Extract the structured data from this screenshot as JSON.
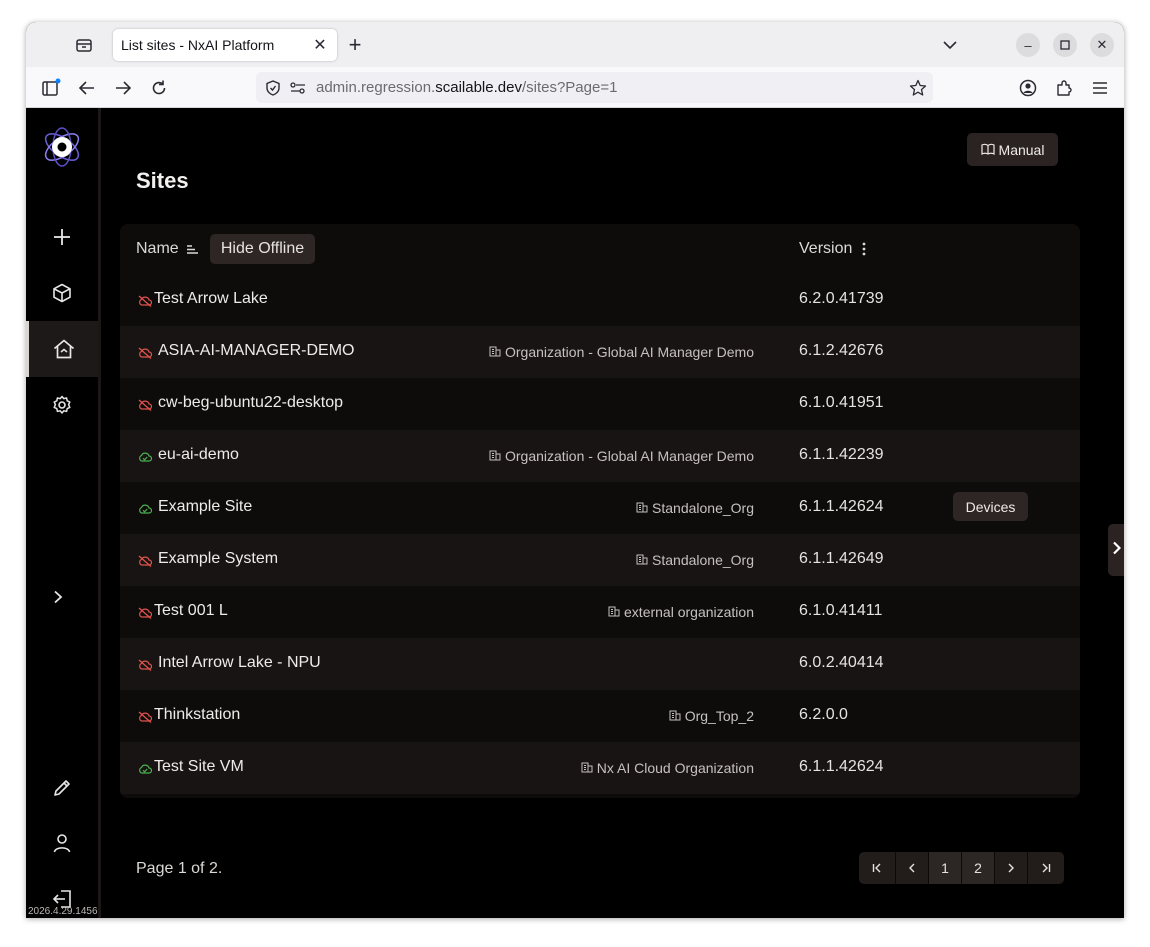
{
  "browser": {
    "tab_title": "List sites - NxAI Platform",
    "url_prefix": "admin.regression.",
    "url_domain": "scailable.dev",
    "url_path": "/sites?Page=1"
  },
  "sidebar": {
    "version": "2026.4.29.1456"
  },
  "page": {
    "title": "Sites",
    "manual_label": "Manual"
  },
  "table": {
    "col_name": "Name",
    "hide_offline_label": "Hide Offline",
    "col_version": "Version",
    "devices_label": "Devices",
    "rows": [
      {
        "name": "Test Arrow Lake",
        "org": "",
        "version": "6.2.0.41739",
        "status": "offline"
      },
      {
        "name": "ASIA-AI-MANAGER-DEMO",
        "org": "Organization - Global AI Manager Demo",
        "version": "6.1.2.42676",
        "status": "offline"
      },
      {
        "name": "cw-beg-ubuntu22-desktop",
        "org": "",
        "version": "6.1.0.41951",
        "status": "offline"
      },
      {
        "name": "eu-ai-demo",
        "org": "Organization - Global AI Manager Demo",
        "version": "6.1.1.42239",
        "status": "online"
      },
      {
        "name": "Example Site",
        "org": "Standalone_Org",
        "version": "6.1.1.42624",
        "status": "online"
      },
      {
        "name": "Example System",
        "org": "Standalone_Org",
        "version": "6.1.1.42649",
        "status": "offline"
      },
      {
        "name": "Test 001 L",
        "org": "external organization",
        "version": "6.1.0.41411",
        "status": "offline"
      },
      {
        "name": "Intel Arrow Lake - NPU",
        "org": "",
        "version": "6.0.2.40414",
        "status": "offline"
      },
      {
        "name": "Thinkstation",
        "org": "Org_Top_2",
        "version": "6.2.0.0",
        "status": "offline"
      },
      {
        "name": "Test Site VM",
        "org": "Nx AI Cloud Organization",
        "version": "6.1.1.42624",
        "status": "online"
      }
    ]
  },
  "pagination": {
    "info": "Page 1 of 2.",
    "first": "⏮",
    "prev": "‹",
    "page1": "1",
    "page2": "2",
    "next": "›",
    "last": "⏭"
  },
  "colors": {
    "offline": "#e0534d",
    "online": "#4caf50",
    "accent": "#7b6cf0"
  }
}
